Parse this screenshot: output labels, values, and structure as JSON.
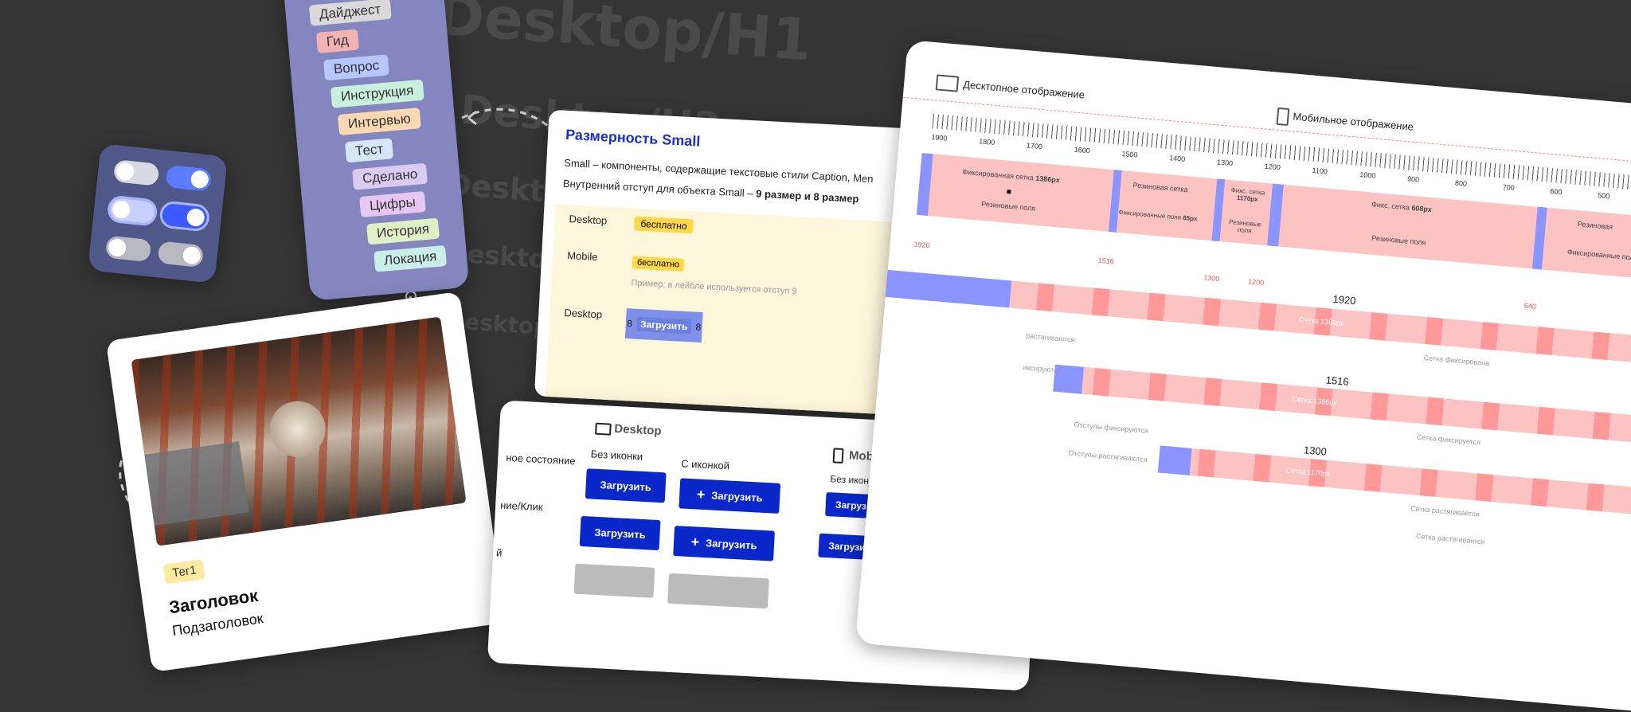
{
  "background_text": [
    "Desktop/H1",
    "Desktop/H2",
    "Desktop/H3",
    "Desktop/H4",
    "Desktop/H5"
  ],
  "tags": [
    {
      "label": "Дайджест",
      "color": "#d9d9d9"
    },
    {
      "label": "Гид",
      "color": "#f4b3b3"
    },
    {
      "label": "Вопрос",
      "color": "#b8c6ff"
    },
    {
      "label": "Инструкция",
      "color": "#c9f0dc"
    },
    {
      "label": "Интервью",
      "color": "#fcd9b2"
    },
    {
      "label": "Тест",
      "color": "#d7e6f5"
    },
    {
      "label": "Сделано",
      "color": "#dacbf2"
    },
    {
      "label": "Цифры",
      "color": "#e7c6f2"
    },
    {
      "label": "История",
      "color": "#dff0c6"
    },
    {
      "label": "Локация",
      "color": "#c9eee7"
    }
  ],
  "photo_card": {
    "tag": "Тег1",
    "title": "Заголовок",
    "subtitle": "Подзаголовок"
  },
  "small_card": {
    "title": "Размерность Small",
    "desc1": "Small – компоненты, содержащие текстовые стили Caption, Men",
    "desc2_prefix": "Внутренний отступ для объекта Small – ",
    "desc2_bold": "9 размер и 8 размер",
    "row1_label": "Desktop",
    "row1_chip": "бесплатно",
    "row2_label": "Mobile",
    "row2_chip": "бесплатно",
    "row2_hint": "Пример: в лейбле используется отступ 9",
    "row3_label": "Desktop",
    "row3_btn": "Загрузить",
    "pad": "8"
  },
  "buttons_card": {
    "desktop": "Desktop",
    "mobile": "Mobile",
    "no_icon": "Без иконки",
    "with_icon": "С иконкой",
    "state1": "ное состояние",
    "state2": "ние/Клик",
    "state3": "й",
    "btn": "Загрузить",
    "plus": "+"
  },
  "grid_card": {
    "desktop_label": "Десктопное отображение",
    "mobile_label": "Мобильное отображение",
    "ruler": [
      "1900",
      "1800",
      "1700",
      "1600",
      "1500",
      "1400",
      "1300",
      "1200",
      "1100",
      "1000",
      "900",
      "800",
      "700",
      "600",
      "500"
    ],
    "seg1_title": "Фиксированная сетка",
    "seg1_px": "1386px",
    "seg1_sub": "Резиновые поля",
    "seg2_title": "Резиновая сетка",
    "seg2_sub": "Фиксированные поля",
    "seg2_px": "65px",
    "seg3_title": "Фикс. сетка",
    "seg3_px": "1170px",
    "seg3_sub": "Резиновые поля",
    "seg4_title": "Фикс. сетка",
    "seg4_px": "608px",
    "seg4_sub": "Резиновые поля",
    "seg5_title": "Резиновая",
    "seg5_sub": "Фиксированные поля",
    "marks": [
      "1920",
      "1516",
      "1300",
      "1200",
      "640"
    ],
    "bar1": "1920",
    "bar1_in": "Сетка 1386px",
    "bar2": "1516",
    "bar2_in": "Сетка 1386px",
    "bar3": "1300",
    "bar3_in": "Сетка 1170px",
    "note1": "Сетка фиксирована",
    "note2": "Сетка фиксируется",
    "note3": "Сетка растягивается",
    "note4": "Отступы фиксируются",
    "note5": "Отступы растягиваются",
    "note6": "Сетка растягивается",
    "left1": "растягиваются",
    "left2": "иксируются"
  }
}
